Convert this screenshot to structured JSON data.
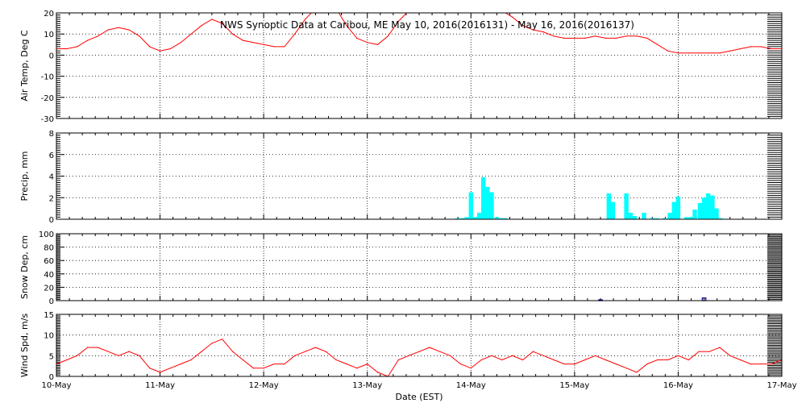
{
  "title": "NWS Synoptic Data at Caribou, ME   May 10, 2016(2016131) - May 16, 2016(2016137)",
  "xlabel": "Date (EST)",
  "colors": {
    "temp": "#ff0000",
    "precip": "#00ffff",
    "snow": "#00008b",
    "wind": "#ff0000",
    "grid": "#000000"
  },
  "chart_data": [
    {
      "type": "line",
      "name": "temp",
      "ylabel": "Air Temp, Deg C",
      "ylim": [
        -30,
        20
      ],
      "yticks": [
        -30,
        -20,
        -10,
        0,
        10,
        20
      ],
      "xlim": [
        0,
        7
      ],
      "xtick_labels": [
        "10-May",
        "11-May",
        "12-May",
        "13-May",
        "14-May",
        "15-May",
        "16-May",
        "17-May"
      ],
      "grid": true,
      "x": [
        0,
        0.1,
        0.2,
        0.3,
        0.4,
        0.5,
        0.6,
        0.7,
        0.8,
        0.9,
        1.0,
        1.1,
        1.2,
        1.3,
        1.4,
        1.5,
        1.6,
        1.7,
        1.8,
        1.9,
        2.0,
        2.1,
        2.2,
        2.3,
        2.4,
        2.5,
        2.6,
        2.7,
        2.8,
        2.9,
        3.0,
        3.1,
        3.2,
        3.3,
        3.4,
        3.5,
        3.6,
        3.7,
        3.8,
        3.9,
        4.0,
        4.1,
        4.2,
        4.3,
        4.4,
        4.5,
        4.6,
        4.7,
        4.8,
        4.9,
        5.0,
        5.1,
        5.2,
        5.3,
        5.4,
        5.5,
        5.6,
        5.7,
        5.8,
        5.9,
        6.0,
        6.1,
        6.2,
        6.3,
        6.4,
        6.5,
        6.6,
        6.7,
        6.8,
        6.9,
        7.0
      ],
      "y": [
        3,
        3,
        4,
        7,
        9,
        12,
        13,
        12,
        9,
        4,
        2,
        3,
        6,
        10,
        14,
        17,
        15,
        10,
        7,
        6,
        5,
        4,
        4,
        10,
        17,
        22,
        24,
        22,
        14,
        8,
        6,
        5,
        9,
        16,
        21,
        23,
        23,
        22,
        21,
        23,
        24,
        24,
        23,
        21,
        18,
        14,
        12,
        11,
        9,
        8,
        8,
        8,
        9,
        8,
        8,
        9,
        9,
        8,
        5,
        2,
        1,
        1,
        1,
        1,
        1,
        2,
        3,
        4,
        4,
        3,
        3
      ]
    },
    {
      "type": "bar",
      "name": "precip",
      "ylabel": "Precip, mm",
      "ylim": [
        0,
        8
      ],
      "yticks": [
        0,
        2,
        4,
        6,
        8
      ],
      "xlim": [
        0,
        7
      ],
      "grid": true,
      "bar_width": 0.042,
      "x": [
        3.87,
        3.92,
        3.96,
        4.0,
        4.04,
        4.08,
        4.12,
        4.16,
        4.2,
        4.25,
        4.29,
        4.33,
        5.33,
        5.37,
        5.5,
        5.54,
        5.58,
        5.67,
        5.75,
        5.79,
        5.87,
        5.92,
        5.96,
        6.0,
        6.08,
        6.12,
        6.16,
        6.21,
        6.25,
        6.29,
        6.33,
        6.37,
        6.41
      ],
      "values": [
        0.1,
        0.1,
        0.2,
        2.5,
        0.2,
        0.6,
        3.9,
        3.0,
        2.5,
        0.2,
        0.1,
        0.1,
        2.4,
        1.6,
        2.4,
        0.6,
        0.3,
        0.6,
        0.1,
        0.1,
        0.1,
        0.6,
        1.6,
        2.1,
        0.2,
        0.2,
        0.9,
        1.5,
        2.0,
        2.4,
        2.2,
        1.0,
        0.1
      ]
    },
    {
      "type": "bar",
      "name": "snow",
      "ylabel": "Snow Dep, cm",
      "ylim": [
        0,
        100
      ],
      "yticks": [
        0,
        20,
        40,
        60,
        80,
        100
      ],
      "xlim": [
        0,
        7
      ],
      "grid": true,
      "bar_width": 0.035,
      "x": [
        5.25,
        6.25
      ],
      "values": [
        1,
        4
      ]
    },
    {
      "type": "line",
      "name": "wind",
      "ylabel": "Wind Spd, m/s",
      "ylim": [
        0,
        15
      ],
      "yticks": [
        0,
        5,
        10,
        15
      ],
      "xlim": [
        0,
        7
      ],
      "grid": true,
      "x": [
        0,
        0.1,
        0.2,
        0.3,
        0.4,
        0.5,
        0.6,
        0.7,
        0.8,
        0.9,
        1.0,
        1.1,
        1.2,
        1.3,
        1.4,
        1.5,
        1.6,
        1.7,
        1.8,
        1.9,
        2.0,
        2.1,
        2.2,
        2.3,
        2.4,
        2.5,
        2.6,
        2.7,
        2.8,
        2.9,
        3.0,
        3.1,
        3.2,
        3.3,
        3.4,
        3.5,
        3.6,
        3.7,
        3.8,
        3.9,
        4.0,
        4.1,
        4.2,
        4.3,
        4.4,
        4.5,
        4.6,
        4.7,
        4.8,
        4.9,
        5.0,
        5.1,
        5.2,
        5.3,
        5.4,
        5.5,
        5.6,
        5.7,
        5.8,
        5.9,
        6.0,
        6.1,
        6.2,
        6.3,
        6.4,
        6.5,
        6.6,
        6.7,
        6.8,
        6.9,
        7.0
      ],
      "y": [
        3,
        4,
        5,
        7,
        7,
        6,
        5,
        6,
        5,
        2,
        1,
        2,
        3,
        4,
        6,
        8,
        9,
        6,
        4,
        2,
        2,
        3,
        3,
        5,
        6,
        7,
        6,
        4,
        3,
        2,
        3,
        1,
        0,
        4,
        5,
        6,
        7,
        6,
        5,
        3,
        2,
        4,
        5,
        4,
        5,
        4,
        6,
        5,
        4,
        3,
        3,
        4,
        5,
        4,
        3,
        2,
        1,
        3,
        4,
        4,
        5,
        4,
        6,
        6,
        7,
        5,
        4,
        3,
        3,
        3,
        4
      ]
    }
  ]
}
